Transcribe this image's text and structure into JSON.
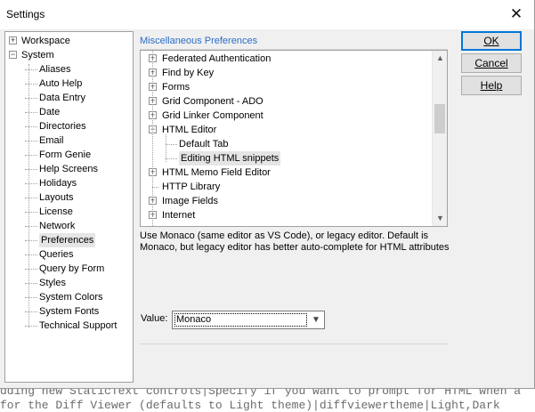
{
  "window": {
    "title": "Settings"
  },
  "buttons": {
    "ok": "OK",
    "cancel": "Cancel",
    "help": "Help"
  },
  "nav_tree": {
    "items": [
      {
        "label": "Workspace",
        "level": 0,
        "expander": "+"
      },
      {
        "label": "System",
        "level": 0,
        "expander": "−"
      },
      {
        "label": "Aliases",
        "level": 1
      },
      {
        "label": "Auto Help",
        "level": 1
      },
      {
        "label": "Data Entry",
        "level": 1
      },
      {
        "label": "Date",
        "level": 1
      },
      {
        "label": "Directories",
        "level": 1
      },
      {
        "label": "Email",
        "level": 1
      },
      {
        "label": "Form Genie",
        "level": 1
      },
      {
        "label": "Help Screens",
        "level": 1
      },
      {
        "label": "Holidays",
        "level": 1
      },
      {
        "label": "Layouts",
        "level": 1
      },
      {
        "label": "License",
        "level": 1
      },
      {
        "label": "Network",
        "level": 1
      },
      {
        "label": "Preferences",
        "level": 1,
        "selected": true
      },
      {
        "label": "Queries",
        "level": 1
      },
      {
        "label": "Query by Form",
        "level": 1
      },
      {
        "label": "Styles",
        "level": 1
      },
      {
        "label": "System Colors",
        "level": 1
      },
      {
        "label": "System Fonts",
        "level": 1
      },
      {
        "label": "Technical Support",
        "level": 1
      }
    ]
  },
  "group": {
    "title": "Miscellaneous Preferences"
  },
  "pref_tree": {
    "items": [
      {
        "label": "Federated Authentication",
        "level": 0,
        "expander": "+"
      },
      {
        "label": "Find by Key",
        "level": 0,
        "expander": "+"
      },
      {
        "label": "Forms",
        "level": 0,
        "expander": "+"
      },
      {
        "label": "Grid Component - ADO",
        "level": 0,
        "expander": "+"
      },
      {
        "label": "Grid Linker Component",
        "level": 0,
        "expander": "+"
      },
      {
        "label": "HTML Editor",
        "level": 0,
        "expander": "−"
      },
      {
        "label": "Default Tab",
        "level": 1
      },
      {
        "label": "Editing HTML snippets",
        "level": 1,
        "selected": true
      },
      {
        "label": "HTML Memo Field Editor",
        "level": 0,
        "expander": "+"
      },
      {
        "label": "HTTP Library",
        "level": 0
      },
      {
        "label": "Image Fields",
        "level": 0,
        "expander": "+"
      },
      {
        "label": "Internet",
        "level": 0,
        "expander": "+"
      }
    ]
  },
  "description": {
    "line1": "Use Monaco (same editor as VS Code), or legacy editor. Default is",
    "line2": "Monaco, but legacy editor has better auto-complete for HTML attributes"
  },
  "value": {
    "label": "Value:",
    "selected": "Monaco"
  },
  "background_text": {
    "line1": "dding new StaticText controls|Specify if you want to prompt for HTML when a",
    "line2": "for the Diff Viewer (defaults to Light theme)|diffviewertheme|Light,Dark"
  }
}
